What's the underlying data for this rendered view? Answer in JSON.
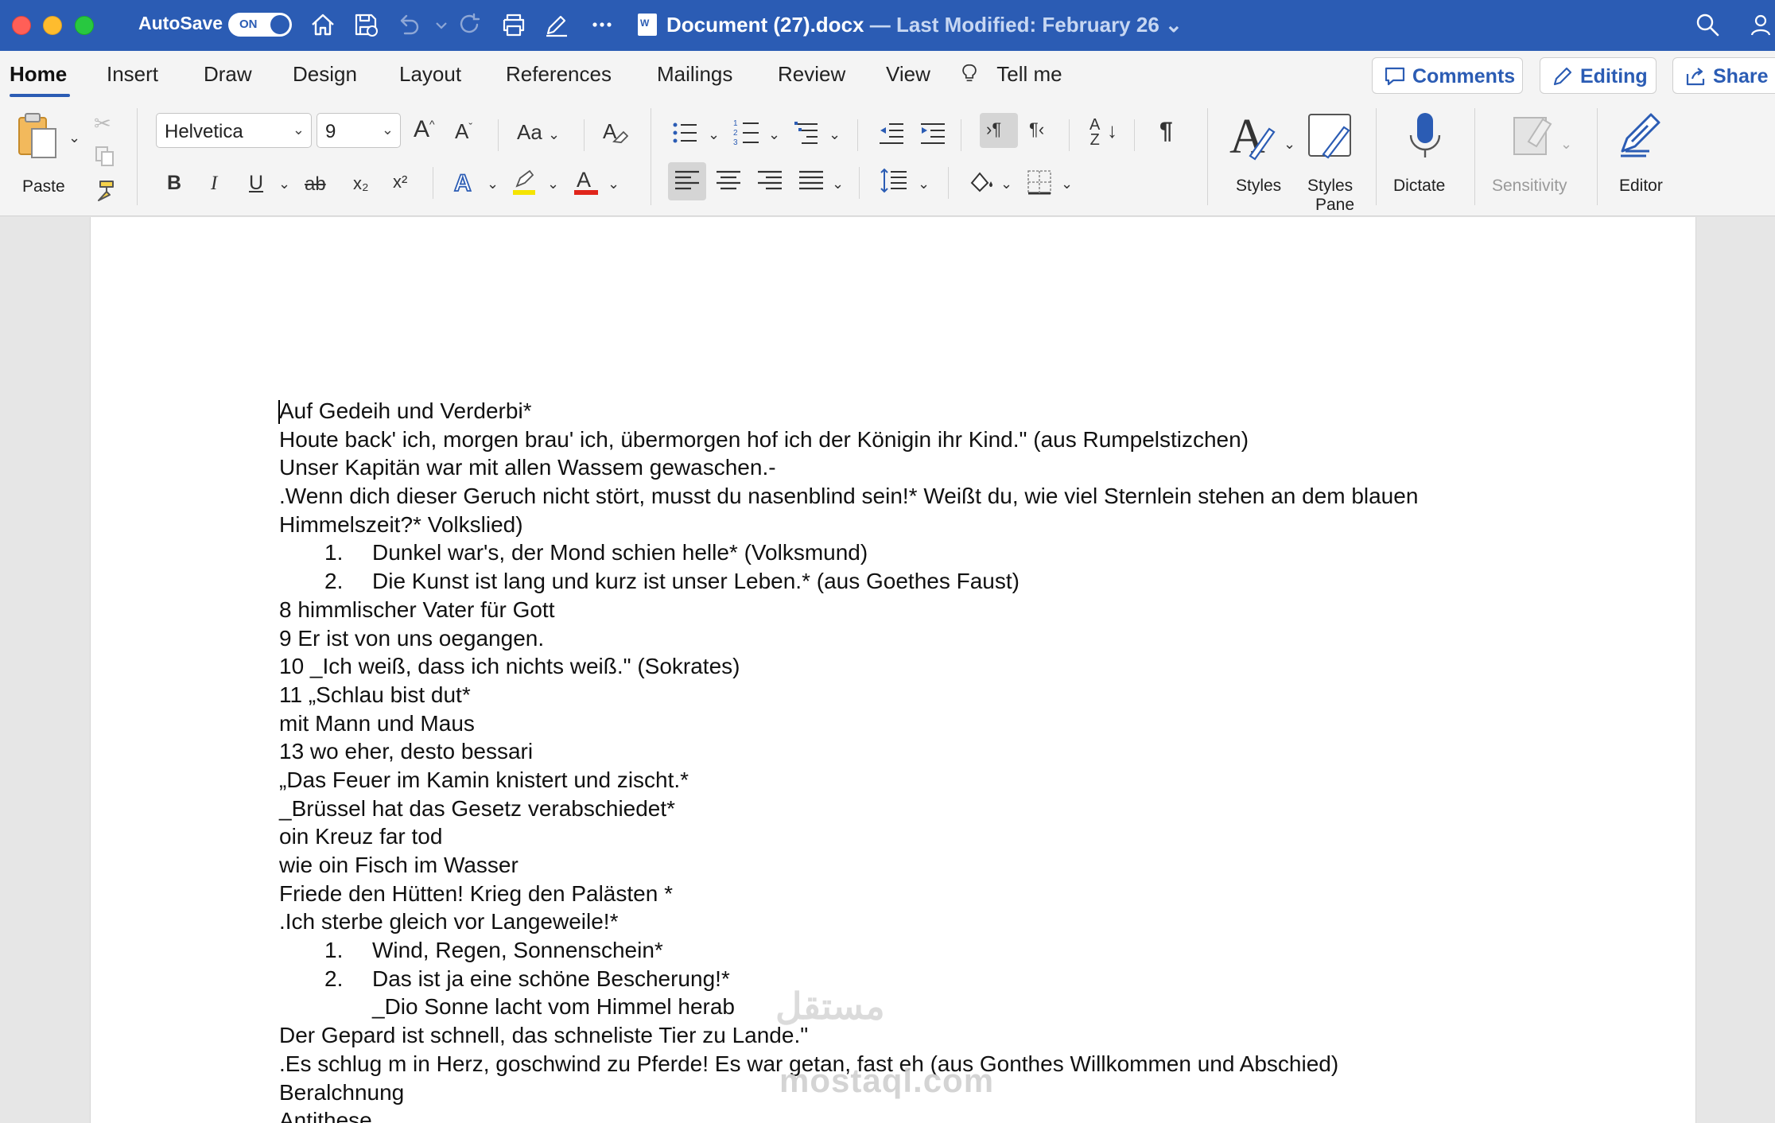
{
  "titlebar": {
    "autosave_label": "AutoSave",
    "autosave_state": "ON",
    "doc_name": "Document (27).docx",
    "doc_modified": " — Last Modified: February 26"
  },
  "tabs": [
    {
      "label": "Home",
      "active": true
    },
    {
      "label": "Insert"
    },
    {
      "label": "Draw"
    },
    {
      "label": "Design"
    },
    {
      "label": "Layout"
    },
    {
      "label": "References"
    },
    {
      "label": "Mailings"
    },
    {
      "label": "Review"
    },
    {
      "label": "View"
    },
    {
      "label": "Tell me"
    }
  ],
  "topbuttons": {
    "comments": "Comments",
    "editing": "Editing",
    "share": "Share"
  },
  "ribbon": {
    "paste": "Paste",
    "font_name": "Helvetica",
    "font_size": "9",
    "styles": "Styles",
    "styles_pane_1": "Styles",
    "styles_pane_2": "Pane",
    "dictate": "Dictate",
    "sensitivity": "Sensitivity",
    "editor": "Editor",
    "bold": "B",
    "italic": "I",
    "underline": "U",
    "strike": "ab",
    "subscript": "x₂",
    "superscript": "x²",
    "grow_font": "A^",
    "shrink_font": "Aˇ",
    "change_case": "Aa",
    "font_color_letter": "A",
    "sort": "A↓Z",
    "pilcrow": "¶"
  },
  "document": {
    "lines": [
      {
        "text": "Auf Gedeih und Verderbi*"
      },
      {
        "text": "Houte back' ich, morgen brau' ich, übermorgen hof ich der Königin ihr Kind.\" (aus Rumpelstizchen)"
      },
      {
        "text": "Unser Kapitän war mit allen Wassem gewaschen.-"
      },
      {
        "text": ".Wenn dich dieser Geruch nicht stört, musst du nasenblind sein!* Weißt du, wie viel Sternlein stehen an dem blauen"
      },
      {
        "text": "Himmelszeit?* Volkslied)"
      },
      {
        "num": "1.",
        "text": "Dunkel war's, der Mond schien helle* (Volksmund)"
      },
      {
        "num": "2.",
        "text": "Die Kunst ist lang und kurz ist unser Leben.* (aus Goethes Faust)"
      },
      {
        "text": "8 himmlischer Vater für Gott"
      },
      {
        "text": "9 Er ist von uns oegangen."
      },
      {
        "text": "10 _Ich weiß, dass ich nichts weiß.\" (Sokrates)"
      },
      {
        "text": "11 „Schlau bist dut*"
      },
      {
        "text": "mit Mann und Maus"
      },
      {
        "text": "13 wo eher, desto bessari"
      },
      {
        "text": "„Das Feuer im Kamin knistert und zischt.*"
      },
      {
        "text": "_Brüssel hat das Gesetz verabschiedet*"
      },
      {
        "text": "oin Kreuz far tod"
      },
      {
        "text": "wie oin Fisch im Wasser"
      },
      {
        "text": "Friede den Hütten! Krieg den Palästen *"
      },
      {
        "text": ".Ich sterbe gleich vor Langeweile!*"
      },
      {
        "num": "1.",
        "text": "Wind, Regen, Sonnenschein*"
      },
      {
        "num": "2.",
        "text": "Das ist ja eine schöne Bescherung!*"
      },
      {
        "cont": true,
        "text": "_Dio Sonne lacht vom Himmel herab"
      },
      {
        "text": "Der Gepard ist schnell, das schneliste Tier zu Lande.\""
      },
      {
        "text": ".Es schlug m in Herz, goschwind zu Pferde! Es war getan, fast eh (aus Gonthes Willkommen und Abschied)"
      },
      {
        "text": "Beralchnung"
      },
      {
        "text": "Antithese"
      }
    ]
  },
  "watermark": {
    "arabic": "مستقل",
    "latin": "mostaql.com"
  },
  "colors": {
    "titlebar": "#2b5cb4",
    "ribbon": "#f4f4f4",
    "accent": "#2b5cb4"
  }
}
